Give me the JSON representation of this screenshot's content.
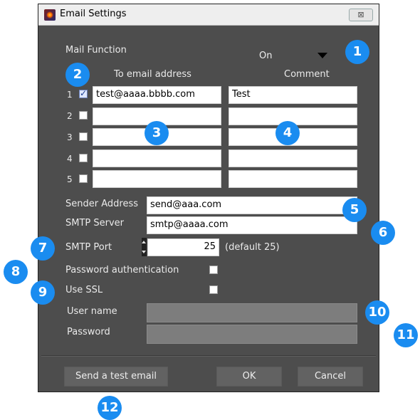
{
  "window": {
    "title": "Email Settings",
    "close_label": "⊠"
  },
  "mail_function": {
    "label": "Mail Function",
    "value": "On"
  },
  "recipients": {
    "to_header": "To email address",
    "comment_header": "Comment",
    "rows": [
      {
        "num": "1",
        "checked": true,
        "email": "test@aaaa.bbbb.com",
        "comment": "Test"
      },
      {
        "num": "2",
        "checked": false,
        "email": "",
        "comment": ""
      },
      {
        "num": "3",
        "checked": false,
        "email": "",
        "comment": ""
      },
      {
        "num": "4",
        "checked": false,
        "email": "",
        "comment": ""
      },
      {
        "num": "5",
        "checked": false,
        "email": "",
        "comment": ""
      }
    ]
  },
  "sender": {
    "label": "Sender Address",
    "value": "send@aaa.com"
  },
  "smtp_server": {
    "label": "SMTP Server",
    "value": "smtp@aaaa.com"
  },
  "smtp_port": {
    "label": "SMTP Port",
    "value": "25",
    "hint": "(default 25)"
  },
  "password_auth": {
    "label": "Password authentication",
    "checked": false
  },
  "use_ssl": {
    "label": "Use SSL",
    "checked": false
  },
  "user_name": {
    "label": "User name",
    "value": ""
  },
  "password": {
    "label": "Password",
    "value": ""
  },
  "buttons": {
    "test_email": "Send a test email",
    "ok": "OK",
    "cancel": "Cancel"
  },
  "callouts": [
    "1",
    "2",
    "3",
    "4",
    "5",
    "6",
    "7",
    "8",
    "9",
    "10",
    "11",
    "12"
  ],
  "colors": {
    "callout": "#1a8cf0",
    "window_bg": "#4d4d4d"
  }
}
